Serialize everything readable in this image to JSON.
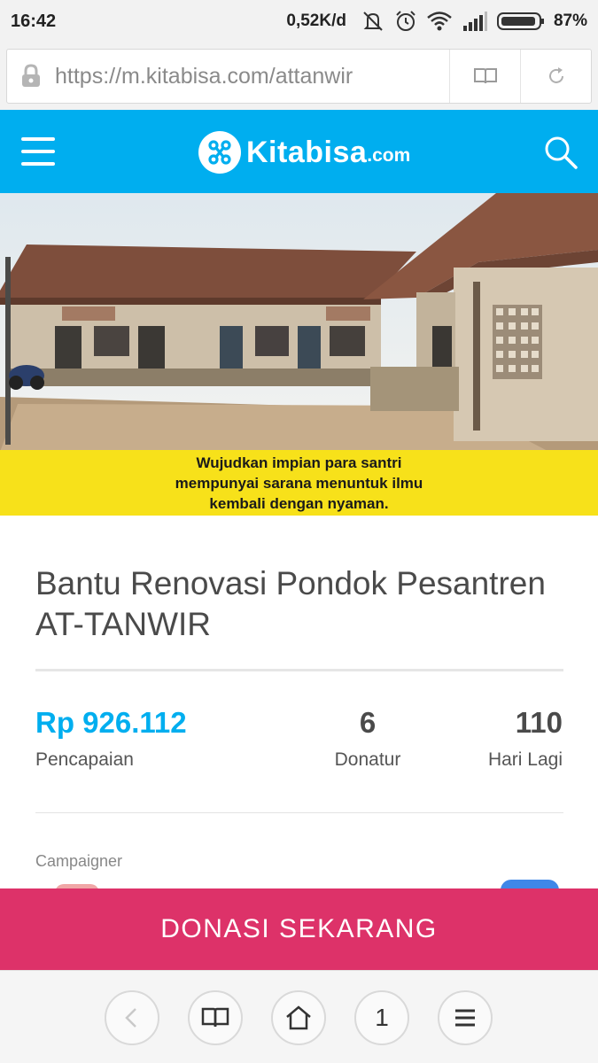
{
  "status_bar": {
    "time": "16:42",
    "network_speed": "0,52K/d",
    "battery_percent": "87%",
    "icons": [
      "mute-icon",
      "alarm-icon",
      "wifi-icon",
      "signal-icon",
      "battery-icon"
    ]
  },
  "browser": {
    "url": "https://m.kitabisa.com/attanwir",
    "icons": [
      "lock-icon",
      "reader-mode-icon",
      "reload-icon"
    ]
  },
  "header": {
    "brand_name": "Kitabisa",
    "brand_tld": ".com",
    "brand_color": "#00aeef",
    "icons": [
      "menu-icon",
      "kitabisa-logo-icon",
      "search-icon"
    ]
  },
  "hero": {
    "caption_lines": [
      "Wujudkan impian para santri",
      "mempunyai sarana menuntuk ilmu",
      "kembali dengan nyaman."
    ],
    "banner_color": "#f7e11a"
  },
  "campaign": {
    "title": "Bantu Renovasi Pondok Pesantren AT-TANWIR",
    "amount_value": "Rp 926.112",
    "amount_label": "Pencapaian",
    "donors_value": "6",
    "donors_label": "Donatur",
    "days_value": "110",
    "days_label": "Hari Lagi",
    "campaigner_label": "Campaigner"
  },
  "cta": {
    "donate_label": "DONASI SEKARANG",
    "color": "#dd3269"
  },
  "bottom_nav": {
    "tabs_count": "1",
    "icons": [
      "back-icon",
      "bookmarks-icon",
      "home-icon",
      "tabs-icon",
      "menu-icon"
    ]
  }
}
